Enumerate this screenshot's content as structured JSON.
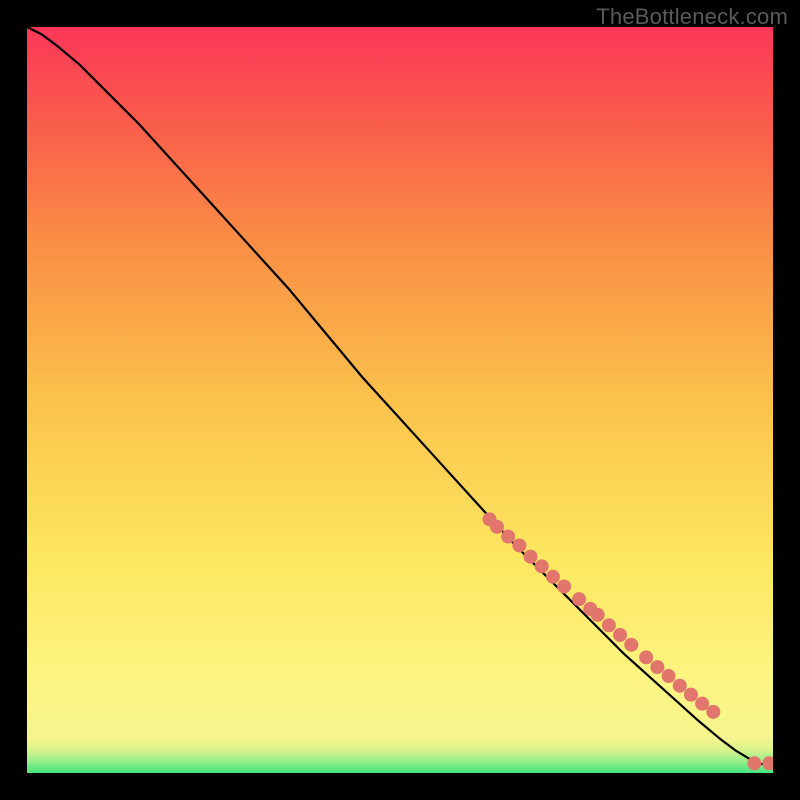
{
  "watermark": "TheBottleneck.com",
  "colors": {
    "dot_fill": "#e2766d",
    "dot_stroke": "#b95048",
    "line": "#000000",
    "axes_bg": "#000000"
  },
  "chart_data": {
    "type": "line",
    "title": "",
    "xlabel": "",
    "ylabel": "",
    "xlim": [
      0,
      100
    ],
    "ylim": [
      0,
      100
    ],
    "grid": false,
    "background": "custom-vertical-gradient",
    "gradient_stops": [
      {
        "offset": 0.0,
        "color": "#45e57d"
      },
      {
        "offset": 0.015,
        "color": "#94ef8b"
      },
      {
        "offset": 0.03,
        "color": "#d6f38e"
      },
      {
        "offset": 0.045,
        "color": "#f4f58e"
      },
      {
        "offset": 0.12,
        "color": "#fdf583"
      },
      {
        "offset": 0.28,
        "color": "#fde861"
      },
      {
        "offset": 0.5,
        "color": "#fbc24b"
      },
      {
        "offset": 0.72,
        "color": "#fa8b45"
      },
      {
        "offset": 0.88,
        "color": "#fa5a4c"
      },
      {
        "offset": 1.0,
        "color": "#fb3759"
      }
    ],
    "series": [
      {
        "name": "curve",
        "type": "line",
        "x": [
          0,
          2,
          4,
          7,
          10,
          15,
          20,
          25,
          30,
          35,
          40,
          45,
          50,
          55,
          60,
          65,
          70,
          75,
          80,
          85,
          90,
          93,
          95,
          97,
          98.5,
          100
        ],
        "y": [
          100,
          99,
          97.5,
          95,
          92,
          87,
          81.5,
          76,
          70.5,
          65,
          59,
          53,
          47.5,
          42,
          36.5,
          31,
          26,
          21,
          16,
          11.5,
          7,
          4.5,
          3,
          1.8,
          1.2,
          1.2
        ]
      },
      {
        "name": "dots",
        "type": "scatter",
        "x": [
          62,
          63,
          64.5,
          66,
          67.5,
          69,
          70.5,
          72,
          74,
          75.5,
          76.5,
          78,
          79.5,
          81,
          83,
          84.5,
          86,
          87.5,
          89,
          90.5,
          92,
          97.5,
          99.5
        ],
        "y": [
          34,
          33,
          31.7,
          30.5,
          29,
          27.7,
          26.3,
          25,
          23.3,
          22,
          21.2,
          19.8,
          18.5,
          17.2,
          15.5,
          14.2,
          13,
          11.7,
          10.5,
          9.3,
          8.2,
          1.3,
          1.3
        ]
      }
    ]
  }
}
